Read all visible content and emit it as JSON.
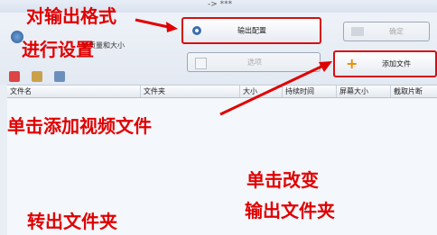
{
  "window": {
    "title": "-> ***"
  },
  "toolbar": {
    "subtitle": "高质量和大小",
    "output_config_label": "输出配置",
    "ok_label": "确定",
    "options_label": "选项",
    "add_file_label": "添加文件"
  },
  "table": {
    "columns": [
      "文件名",
      "文件夹",
      "大小",
      "持续时间",
      "屏幕大小",
      "截取片断"
    ]
  },
  "annotations": {
    "format_line1": "对输出格式",
    "format_line2": "进行设置",
    "add_video": "单击添加视频文件",
    "change_line1": "单击改变",
    "change_line2": "输出文件夹",
    "output_folder": "转出文件夹"
  },
  "colors": {
    "annotation": "#e00000",
    "highlight_border": "#d60f0f",
    "header_bg": "#e4e9f0"
  }
}
